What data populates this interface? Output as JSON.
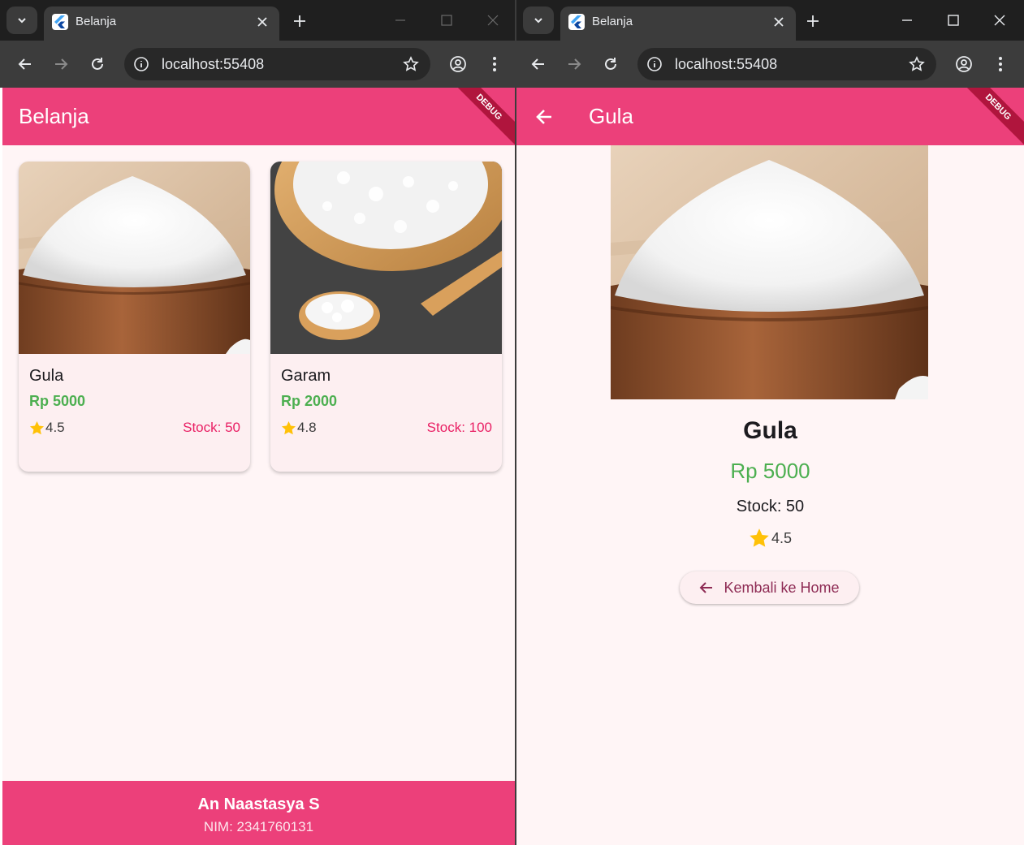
{
  "left": {
    "tab": {
      "title": "Belanja"
    },
    "url": "localhost:55408",
    "appbar": {
      "title": "Belanja",
      "debug": "DEBUG"
    },
    "products": [
      {
        "name": "Gula",
        "price": "Rp 5000",
        "rating": "4.5",
        "stock": "Stock: 50",
        "image": "sugar-bowl"
      },
      {
        "name": "Garam",
        "price": "Rp 2000",
        "rating": "4.8",
        "stock": "Stock: 100",
        "image": "salt-bowl"
      }
    ],
    "footer": {
      "name": "An Naastasya S",
      "nim": "NIM: 2341760131"
    }
  },
  "right": {
    "tab": {
      "title": "Belanja"
    },
    "url": "localhost:55408",
    "appbar": {
      "title": "Gula",
      "debug": "DEBUG"
    },
    "detail": {
      "name": "Gula",
      "price": "Rp 5000",
      "stock": "Stock: 50",
      "rating": "4.5",
      "image": "sugar-bowl"
    },
    "button": {
      "label": "Kembali ke Home"
    }
  },
  "colors": {
    "accent": "#ec407a",
    "price": "#4caf50",
    "stock": "#e91e63",
    "star": "#ffc107",
    "background": "#fff5f6"
  }
}
